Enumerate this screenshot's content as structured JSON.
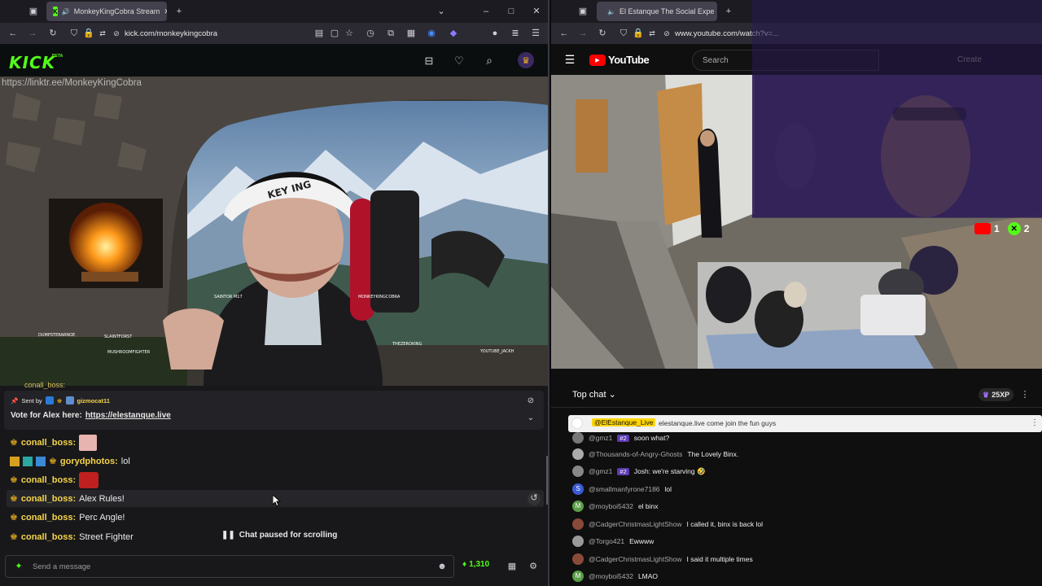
{
  "left_browser": {
    "tab_title": "MonkeyKingCobra Stream",
    "url": "kick.com/monkeykingcobra",
    "kick": {
      "logo": "KICK",
      "beta": "BETA",
      "overlay_link": "https://linktr.ee/MonkeyKingCobra",
      "overlay_names": [
        "SAINTOR M17",
        "MONKEYKINGCOBRA",
        "DUMPSTERARNOE",
        "SLAINTFORST",
        "MUSHROOMFIGHTER",
        "THEZEROKING",
        "YOUTUBE_JACKH"
      ],
      "cap_text": "KEY ING"
    },
    "pinned": {
      "sent_by_label": "Sent by",
      "sent_by_user": "gizmocat11",
      "message": "Vote for Alex here:",
      "link": "https://elestanque.live"
    },
    "chat": {
      "partial_top": "conall_boss:",
      "messages": [
        {
          "user": "conall_boss:",
          "text": "",
          "emote": "face-emote-pink"
        },
        {
          "user": "gorydphotos:",
          "text": "lol",
          "emote": ""
        },
        {
          "user": "conall_boss:",
          "text": "",
          "emote": "face-emote-red"
        },
        {
          "user": "conall_boss:",
          "text": "Alex Rules!",
          "emote": ""
        },
        {
          "user": "conall_boss:",
          "text": "Perc Angle!",
          "emote": ""
        },
        {
          "user": "conall_boss:",
          "text": "Street Fighter",
          "emote": ""
        }
      ],
      "paused_label": "Chat paused for scrolling",
      "input_placeholder": "Send a message",
      "points": "1,310"
    }
  },
  "right_browser": {
    "tab_title": "El Estanque The Social Expe",
    "url": "www.youtube.com/watch?v=...",
    "yt": {
      "logo": "YouTube",
      "search_placeholder": "Search",
      "create_label": "Create",
      "score": {
        "yt": "1",
        "x": "2"
      }
    },
    "chat": {
      "title": "Top chat",
      "xp": "25XP",
      "pinned_author": "@ElEstanque_Live",
      "pinned_text": "elestanque.live come join the fun guys",
      "messages": [
        {
          "author": "@gmz1",
          "badge": "#2",
          "text": "soon what?",
          "color": "#777777"
        },
        {
          "author": "@Thousands-of-Angry-Ghosts",
          "badge": "",
          "text": "The Lovely Binx.",
          "color": "#aaaaaa"
        },
        {
          "author": "@gmz1",
          "badge": "#2",
          "text": "Josh: we're starving 🤣",
          "color": "#888888"
        },
        {
          "author": "@smallmanfyrone7186",
          "badge": "",
          "text": "lol",
          "color": "#3b5bd6",
          "initial": "S"
        },
        {
          "author": "@moyboi5432",
          "badge": "",
          "text": "el binx",
          "color": "#5a9e48",
          "initial": "M"
        },
        {
          "author": "@CadgerChristmasLightShow",
          "badge": "",
          "text": "I called it, binx is back lol",
          "color": "#8a4a3a"
        },
        {
          "author": "@Torgo421",
          "badge": "",
          "text": "Ewwww",
          "color": "#999999"
        },
        {
          "author": "@CadgerChristmasLightShow",
          "badge": "",
          "text": "I said it multiple times",
          "color": "#8a4a3a"
        },
        {
          "author": "@moyboi5432",
          "badge": "",
          "text": "LMAO",
          "color": "#5a9e48",
          "initial": "M"
        }
      ]
    }
  },
  "colors": {
    "kick_green": "#53fc18",
    "yt_red": "#ff0000",
    "chat_user": "#f5d44a"
  }
}
